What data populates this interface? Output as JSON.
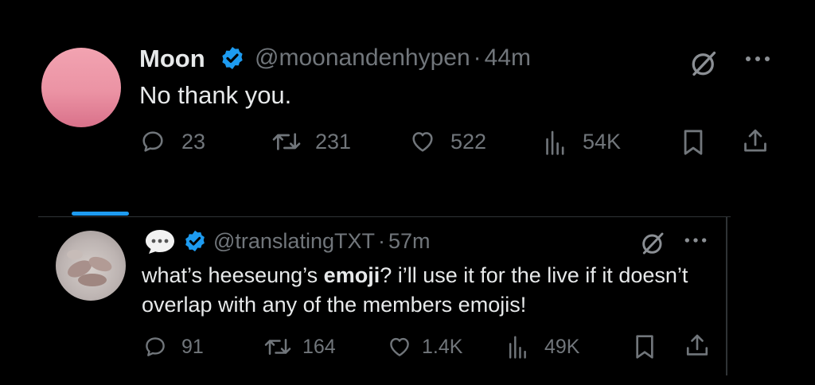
{
  "tweet1": {
    "name": "Moon",
    "handle": "@moonandenhypen",
    "dot": "·",
    "time": "44m",
    "text": "No thank you.",
    "replies": "23",
    "reposts": "231",
    "likes": "522",
    "views": "54K"
  },
  "tweet2": {
    "handle": "@translatingTXT",
    "dot": "·",
    "time": "57m",
    "text_before": "what’s heeseung’s ",
    "text_bold": "emoji",
    "text_after": "? i’ll use it for the live if it doesn’t overlap with any of the members emojis!",
    "replies": "91",
    "reposts": "164",
    "likes": "1.4K",
    "views": "49K"
  },
  "colors": {
    "background": "#000000",
    "text": "#e7e9ea",
    "muted": "#71767b",
    "verified": "#1d9bf0"
  },
  "icons": [
    "verified-badge-icon",
    "grok-icon",
    "more-icon",
    "reply-icon",
    "repost-icon",
    "like-icon",
    "views-icon",
    "bookmark-icon",
    "share-icon",
    "speech-bubble-icon"
  ]
}
